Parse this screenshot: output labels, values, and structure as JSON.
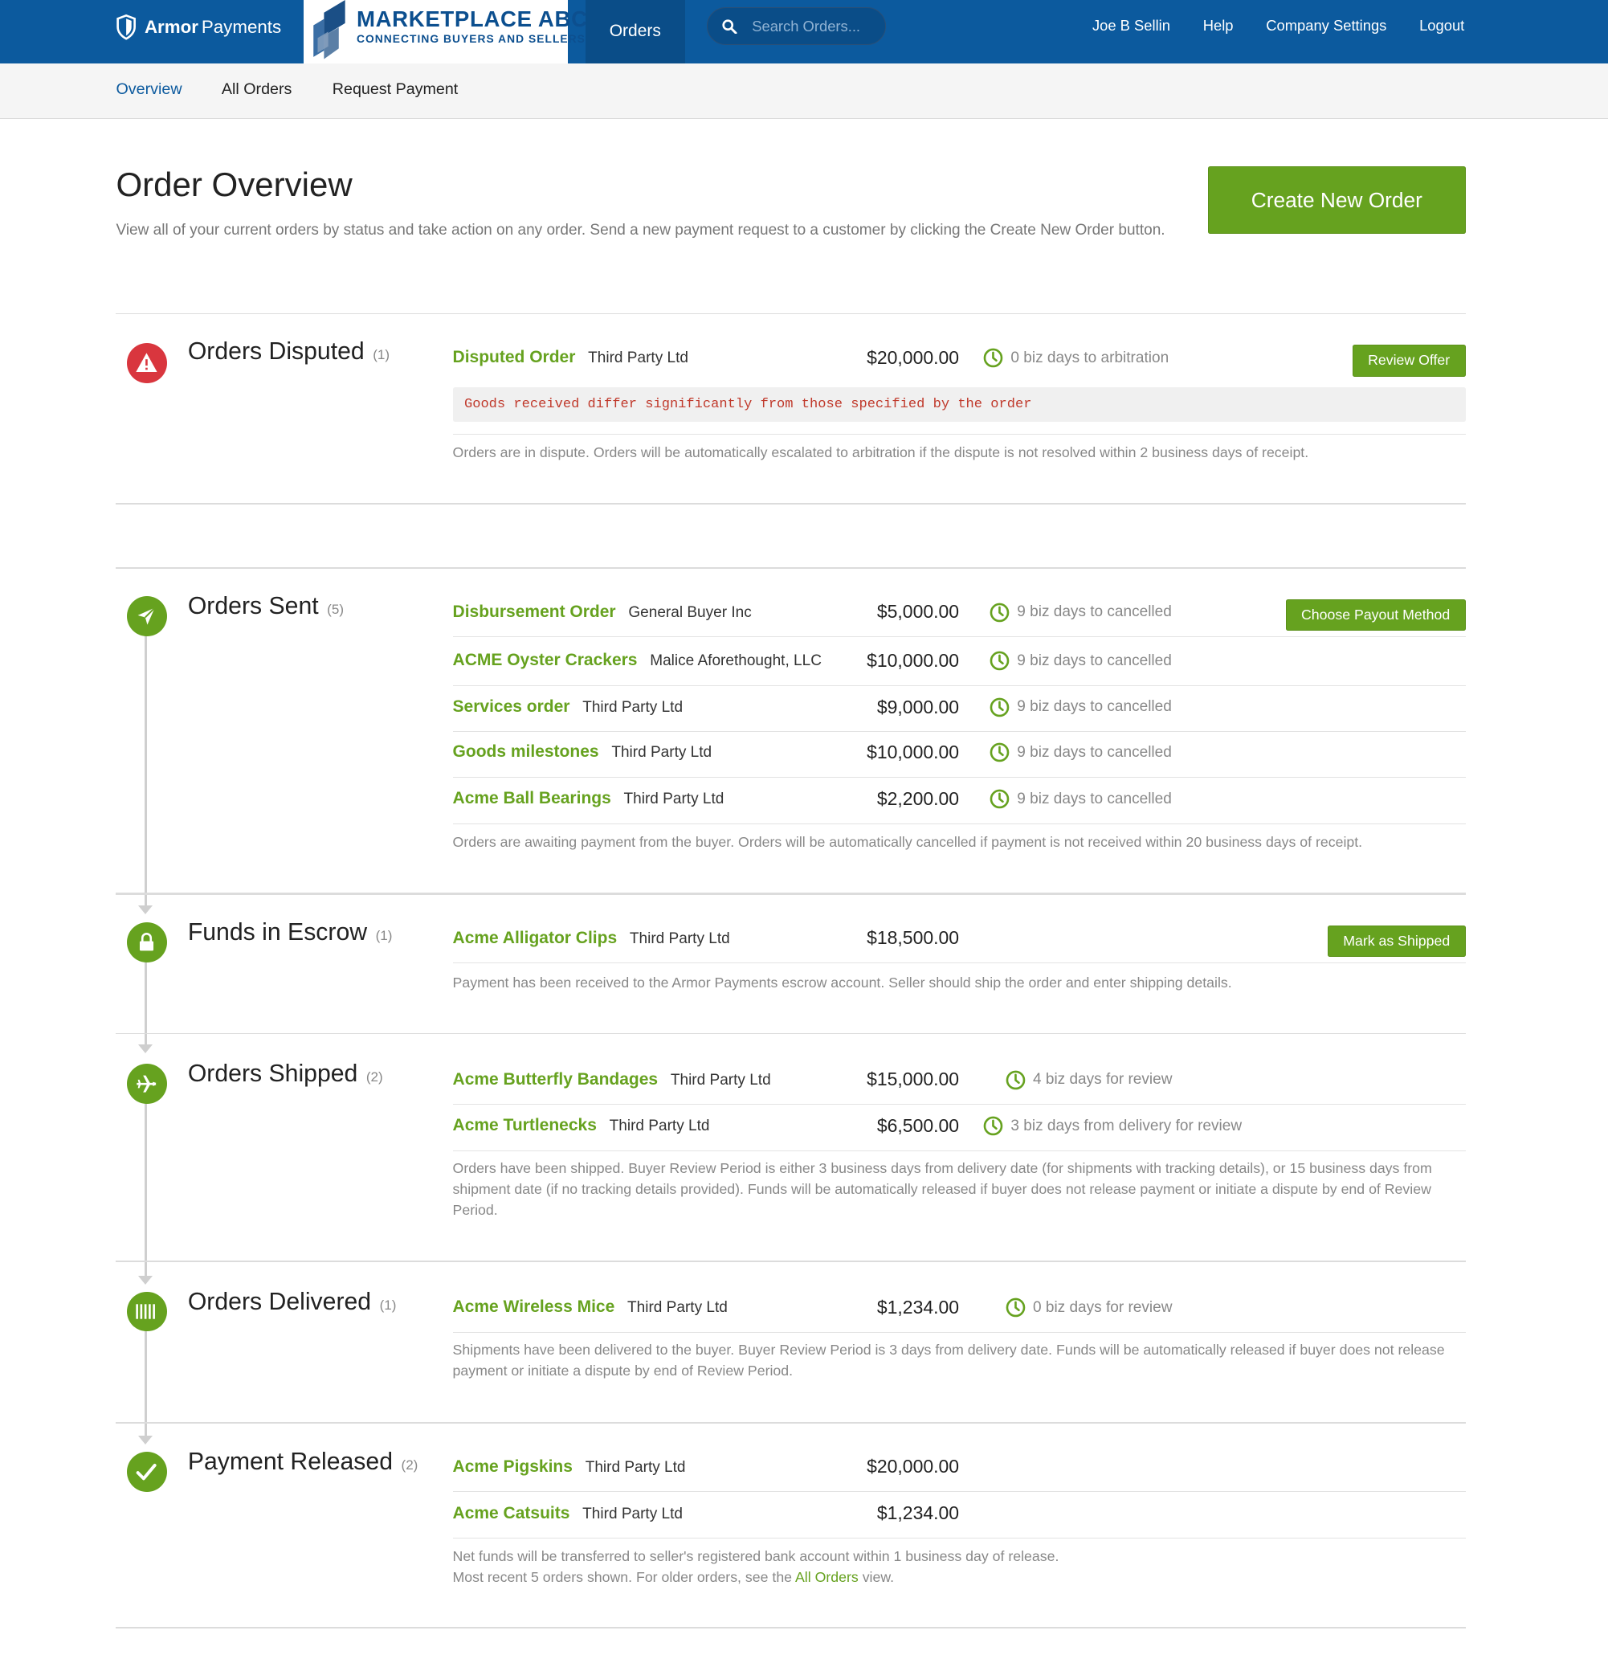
{
  "header": {
    "brand_bold": "Armor",
    "brand_light": "Payments",
    "marketplace_title": "MARKETPLACE ABC",
    "marketplace_tagline": "CONNECTING BUYERS AND SELLERS",
    "nav_orders": "Orders",
    "search_placeholder": "Search Orders...",
    "user_name": "Joe B Sellin",
    "help": "Help",
    "company_settings": "Company Settings",
    "logout": "Logout"
  },
  "subnav": {
    "overview": "Overview",
    "all_orders": "All Orders",
    "request_payment": "Request Payment"
  },
  "page": {
    "title": "Order Overview",
    "description": "View all of your current orders by status and take action on any order. Send a new payment request to a customer by clicking the Create New Order button.",
    "create_button": "Create New Order"
  },
  "colors": {
    "header_bg": "#0c5a9e",
    "accent_green": "#66a21f",
    "alert_red": "#d9363e"
  },
  "sections": {
    "disputed": {
      "title": "Orders Disputed",
      "count": "(1)",
      "icon": "warning-icon",
      "orders": [
        {
          "name": "Disputed Order",
          "party": "Third Party Ltd",
          "amount": "$20,000.00",
          "status": "0 biz days to arbitration",
          "action": "Review Offer"
        }
      ],
      "reason": "Goods received differ significantly from those specified by the order",
      "note": "Orders are in dispute. Orders will be automatically escalated to arbitration if the dispute is not resolved within 2 business days of receipt."
    },
    "sent": {
      "title": "Orders Sent",
      "count": "(5)",
      "icon": "paper-plane-icon",
      "orders": [
        {
          "name": "Disbursement Order",
          "party": "General Buyer Inc",
          "amount": "$5,000.00",
          "status": "9 biz days to cancelled",
          "action": "Choose Payout Method"
        },
        {
          "name": "ACME Oyster Crackers",
          "party": "Malice Aforethought, LLC",
          "amount": "$10,000.00",
          "status": "9 biz days to cancelled"
        },
        {
          "name": "Services order",
          "party": "Third Party Ltd",
          "amount": "$9,000.00",
          "status": "9 biz days to cancelled"
        },
        {
          "name": "Goods milestones",
          "party": "Third Party Ltd",
          "amount": "$10,000.00",
          "status": "9 biz days to cancelled"
        },
        {
          "name": "Acme Ball Bearings",
          "party": "Third Party Ltd",
          "amount": "$2,200.00",
          "status": "9 biz days to cancelled"
        }
      ],
      "note": "Orders are awaiting payment from the buyer. Orders will be automatically cancelled if payment is not received within 20 business days of receipt."
    },
    "escrow": {
      "title": "Funds in Escrow",
      "count": "(1)",
      "icon": "lock-icon",
      "orders": [
        {
          "name": "Acme Alligator Clips",
          "party": "Third Party Ltd",
          "amount": "$18,500.00",
          "action": "Mark as Shipped"
        }
      ],
      "note": "Payment has been received to the Armor Payments escrow account. Seller should ship the order and enter shipping details."
    },
    "shipped": {
      "title": "Orders Shipped",
      "count": "(2)",
      "icon": "airplane-icon",
      "orders": [
        {
          "name": "Acme Butterfly Bandages",
          "party": "Third Party Ltd",
          "amount": "$15,000.00",
          "status": "4 biz days for review"
        },
        {
          "name": "Acme Turtlenecks",
          "party": "Third Party Ltd",
          "amount": "$6,500.00",
          "status": "3 biz days from delivery for review"
        }
      ],
      "note": "Orders have been shipped. Buyer Review Period is either 3 business days from delivery date (for shipments with tracking details), or 15 business days from shipment date (if no tracking details provided). Funds will be automatically released if buyer does not release payment or initiate a dispute by end of Review Period."
    },
    "delivered": {
      "title": "Orders Delivered",
      "count": "(1)",
      "icon": "barcode-icon",
      "orders": [
        {
          "name": "Acme Wireless Mice",
          "party": "Third Party Ltd",
          "amount": "$1,234.00",
          "status": "0 biz days for review"
        }
      ],
      "note": "Shipments have been delivered to the buyer. Buyer Review Period is 3 days from delivery date. Funds will be automatically released if buyer does not release payment or initiate a dispute by end of Review Period."
    },
    "released": {
      "title": "Payment Released",
      "count": "(2)",
      "icon": "checkmark-icon",
      "orders": [
        {
          "name": "Acme Pigskins",
          "party": "Third Party Ltd",
          "amount": "$20,000.00"
        },
        {
          "name": "Acme Catsuits",
          "party": "Third Party Ltd",
          "amount": "$1,234.00"
        }
      ],
      "note_line1": "Net funds will be transferred to seller's registered bank account within 1 business day of release.",
      "note_line2_pre": "Most recent 5 orders shown. For older orders, see the",
      "note_link": "All Orders",
      "note_line2_post": "view."
    }
  }
}
